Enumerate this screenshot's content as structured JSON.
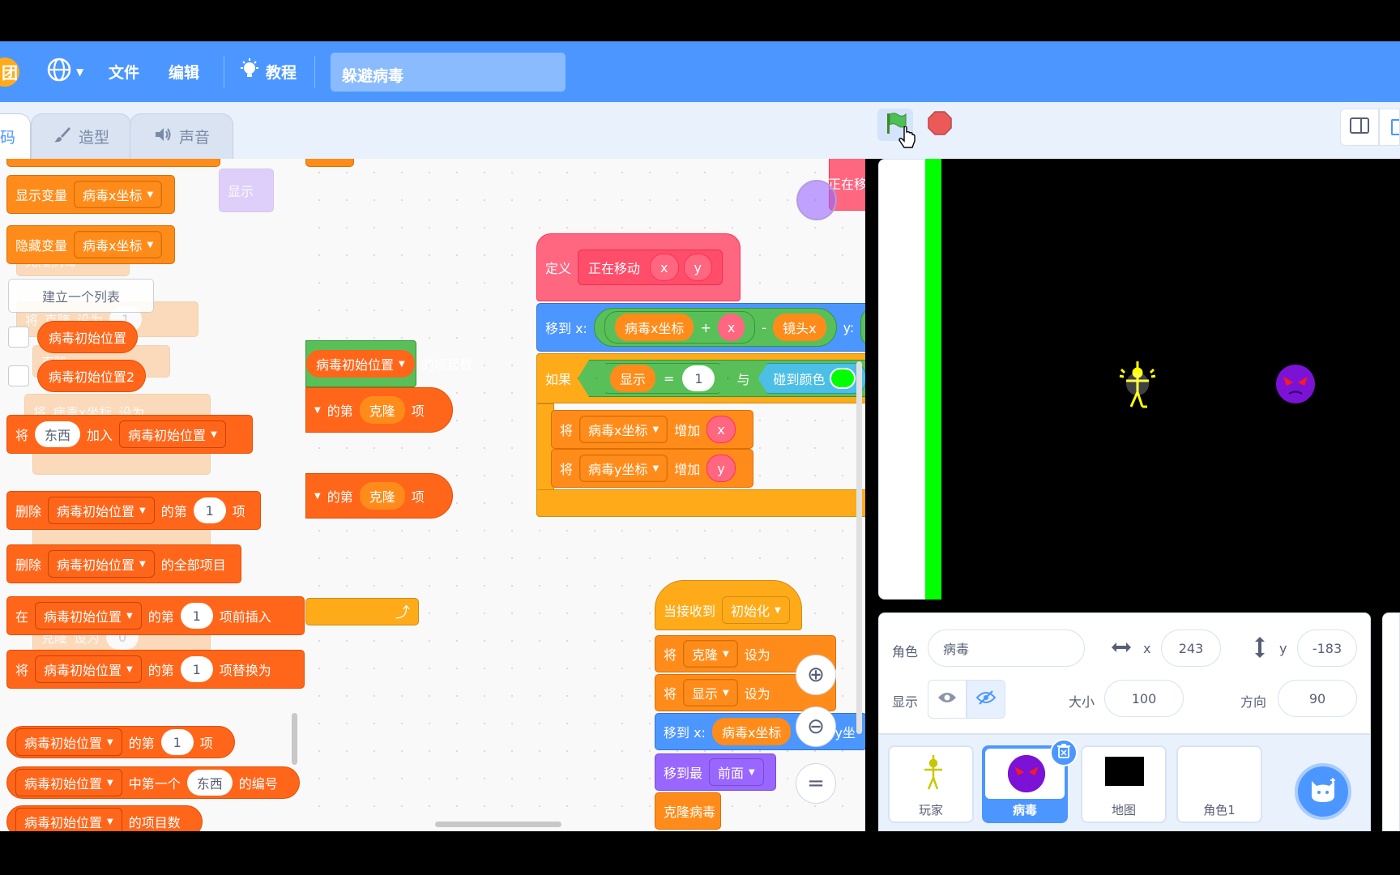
{
  "menu": {
    "file": "文件",
    "edit": "编辑",
    "tutorials": "教程",
    "project_title": "躲避病毒"
  },
  "tabs": {
    "code": "码",
    "costumes": "造型",
    "sounds": "声音"
  },
  "palette": {
    "show_variable": "显示变量",
    "hide_variable": "隐藏变量",
    "var_name": "病毒x坐标",
    "make_list": "建立一个列表",
    "list1": "病毒初始位置",
    "list2": "病毒初始位置2",
    "add_label": "将",
    "add_thing": "东西",
    "add_to": "加入",
    "delete_label": "删除",
    "nth": "的第",
    "item": "项",
    "all_items": "的全部项目",
    "insert_at": "在",
    "insert_before": "项前插入",
    "replace_label": "将",
    "replace_with": "项替换为",
    "item_of": "的第",
    "first_of": "中第一个",
    "index_of": "的编号",
    "length_of": "的项目数",
    "one": "1",
    "ghost_show": "显示",
    "ghost_clone": "克隆病毒",
    "ghost_set": "设为",
    "ghost_clone_var": "克隆",
    "ghost_zero": "0",
    "ghost_add": "增加",
    "ghost_move": "移到最",
    "ghost_item": "项目数"
  },
  "script": {
    "define": "定义",
    "proc_name": "正在移动",
    "arg_x": "x",
    "arg_y": "y",
    "goto_x": "移到 x:",
    "var_x": "病毒x坐标",
    "plus": "+",
    "minus": "-",
    "cam_x": "镜头x",
    "y_label": "y:",
    "y_trunc": "病",
    "if": "如果",
    "show": "显示",
    "eq": "=",
    "one": "1",
    "and": "与",
    "touch_color": "碰到颜色",
    "change_label": "将",
    "var_y": "病毒y坐标",
    "increase": "增加",
    "list_len": "的项目数",
    "nth": "的第",
    "clone_var": "克隆",
    "item": "项",
    "moving_trunc": "正在移",
    "when_receive": "当接收到",
    "init": "初始化",
    "set_label": "将",
    "clone": "克隆",
    "set_to": "设为",
    "display": "显示",
    "goto2": "移到 x:",
    "y_trunc2": "毒y坐",
    "go_to_layer": "移到最",
    "front": "前面",
    "clone_virus": "克隆病毒"
  },
  "sprite_info": {
    "sprite_label": "角色",
    "sprite_name": "病毒",
    "x_label": "x",
    "x_value": "243",
    "y_label": "y",
    "y_value": "-183",
    "show_label": "显示",
    "size_label": "大小",
    "size_value": "100",
    "direction_label": "方向",
    "direction_value": "90"
  },
  "sprites": [
    {
      "name": "玩家"
    },
    {
      "name": "病毒"
    },
    {
      "name": "地图"
    },
    {
      "name": "角色1"
    }
  ]
}
